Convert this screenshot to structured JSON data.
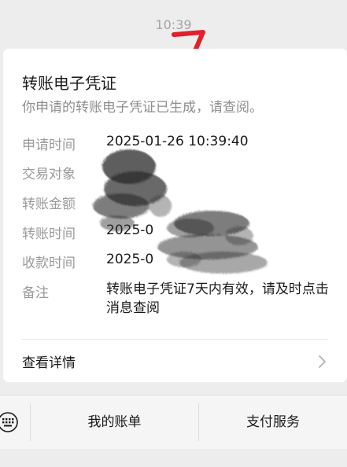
{
  "timestamp": "10:39",
  "annotation_text": "7",
  "card": {
    "title": "转账电子凭证",
    "subtitle": "你申请的转账电子凭证已生成，请查阅。",
    "rows": [
      {
        "label": "申请时间",
        "value": "2025-01-26 10:39:40"
      },
      {
        "label": "交易对象",
        "value": ""
      },
      {
        "label": "转账金额",
        "value": ""
      },
      {
        "label": "转账时间",
        "value": "2025-0"
      },
      {
        "label": "收款时间",
        "value": "2025-0"
      },
      {
        "label": "备注",
        "value": "转账电子凭证7天内有效，请及时点击消息查阅"
      }
    ],
    "details_label": "查看详情"
  },
  "menu": {
    "items": [
      "我的账单",
      "支付服务"
    ]
  },
  "icons": {
    "keyboard": "keyboard-icon",
    "chevron": "chevron-right-icon"
  },
  "colors": {
    "background": "#ededed",
    "card": "#ffffff",
    "annotation": "#e0202a",
    "label": "#9a9a9a",
    "text": "#1a1a1a"
  }
}
